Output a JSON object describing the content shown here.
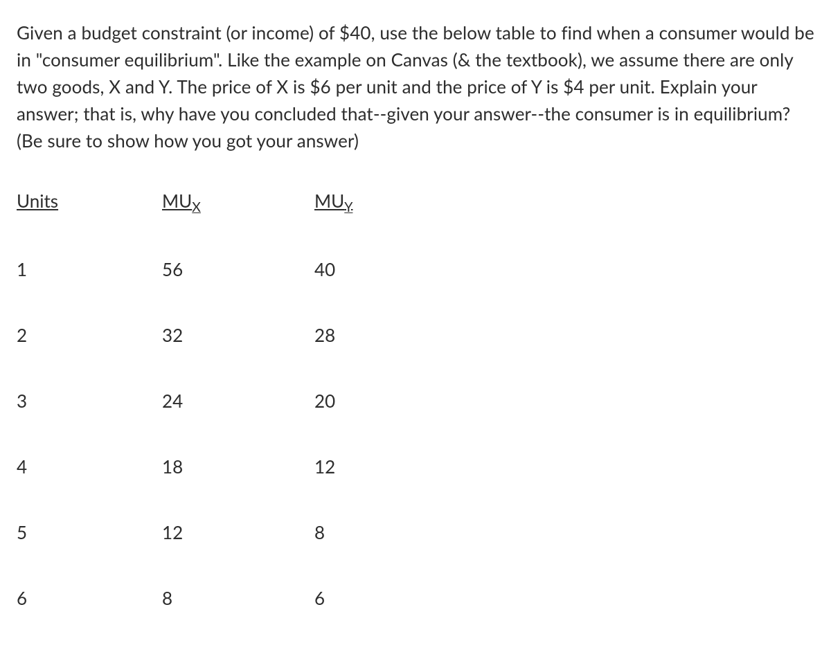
{
  "question_text": "Given a budget constraint (or income) of $40, use the below table to find when a consumer would be in \"consumer equilibrium\". Like the example on Canvas (& the textbook), we assume there are only two goods, X and Y. The price of X is $6 per unit and the price of Y is $4 per unit. Explain your answer; that is, why have you concluded that--given your answer--the consumer is in equilibrium? (Be sure to show how you got your answer)",
  "table": {
    "headers": {
      "units": "Units",
      "mux_prefix": "MU",
      "mux_sub": "X",
      "muy_prefix": "MU",
      "muy_sub": "Y"
    },
    "rows": [
      {
        "units": "1",
        "mux": "56",
        "muy": "40"
      },
      {
        "units": "2",
        "mux": "32",
        "muy": "28"
      },
      {
        "units": "3",
        "mux": "24",
        "muy": "20"
      },
      {
        "units": "4",
        "mux": "18",
        "muy": "12"
      },
      {
        "units": "5",
        "mux": "12",
        "muy": "8"
      },
      {
        "units": "6",
        "mux": "8",
        "muy": "6"
      }
    ]
  }
}
